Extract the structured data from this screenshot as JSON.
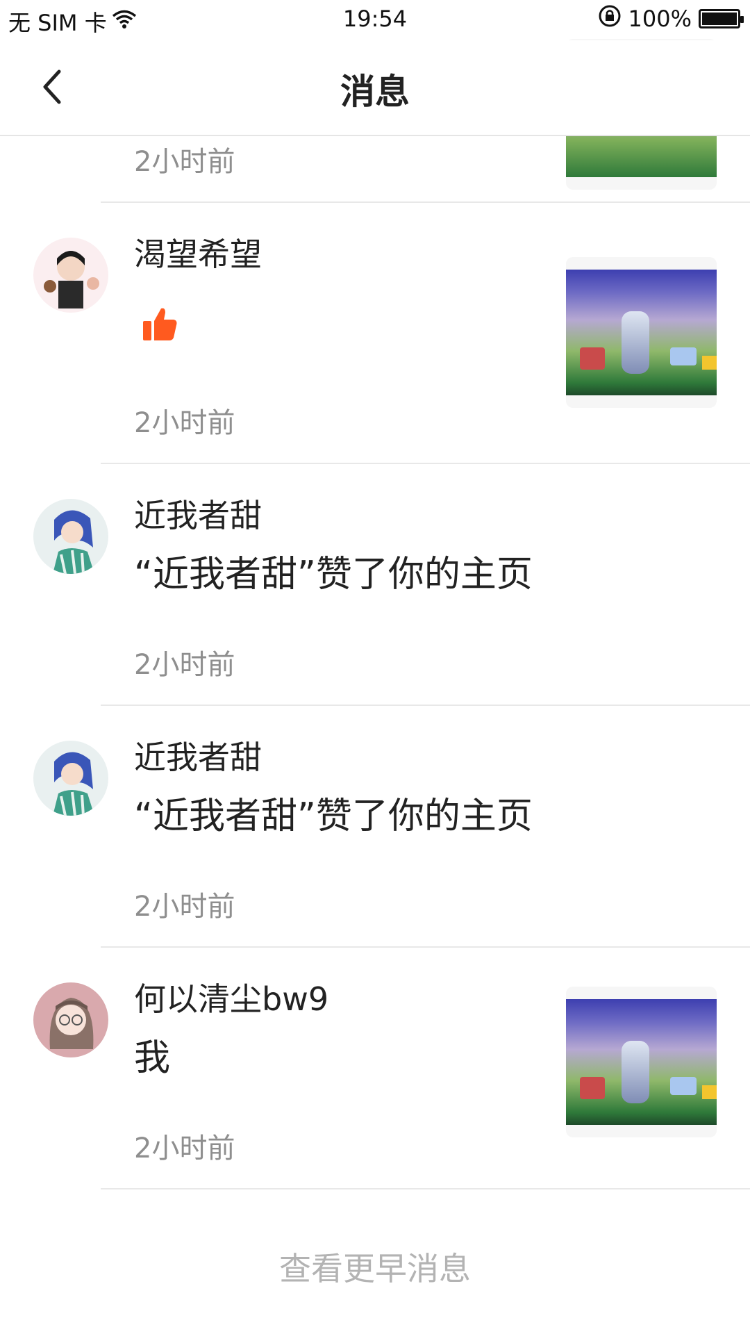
{
  "status_bar": {
    "carrier": "无 SIM 卡",
    "time": "19:54",
    "battery": "100%",
    "icons": [
      "wifi-icon",
      "rotation-lock-icon",
      "battery-icon"
    ]
  },
  "header": {
    "title": "消息",
    "back_icon": "chevron-left-icon"
  },
  "messages": [
    {
      "time": "2小时前"
    },
    {
      "name": "渴望希望",
      "type": "like",
      "icon": "thumbs-up-icon",
      "time": "2小时前",
      "has_thumbnail": true
    },
    {
      "name": "近我者甜",
      "content": "“近我者甜”赞了你的主页",
      "time": "2小时前",
      "has_thumbnail": false
    },
    {
      "name": "近我者甜",
      "content": "“近我者甜”赞了你的主页",
      "time": "2小时前",
      "has_thumbnail": false
    },
    {
      "name": "何以清尘bw9",
      "content": "我",
      "time": "2小时前",
      "has_thumbnail": true
    }
  ],
  "footer": {
    "more_label": "查看更早消息"
  },
  "colors": {
    "accent": "#ff5a1f",
    "text": "#222222",
    "secondary": "#8e8e8e",
    "divider": "#e8e8e8"
  }
}
